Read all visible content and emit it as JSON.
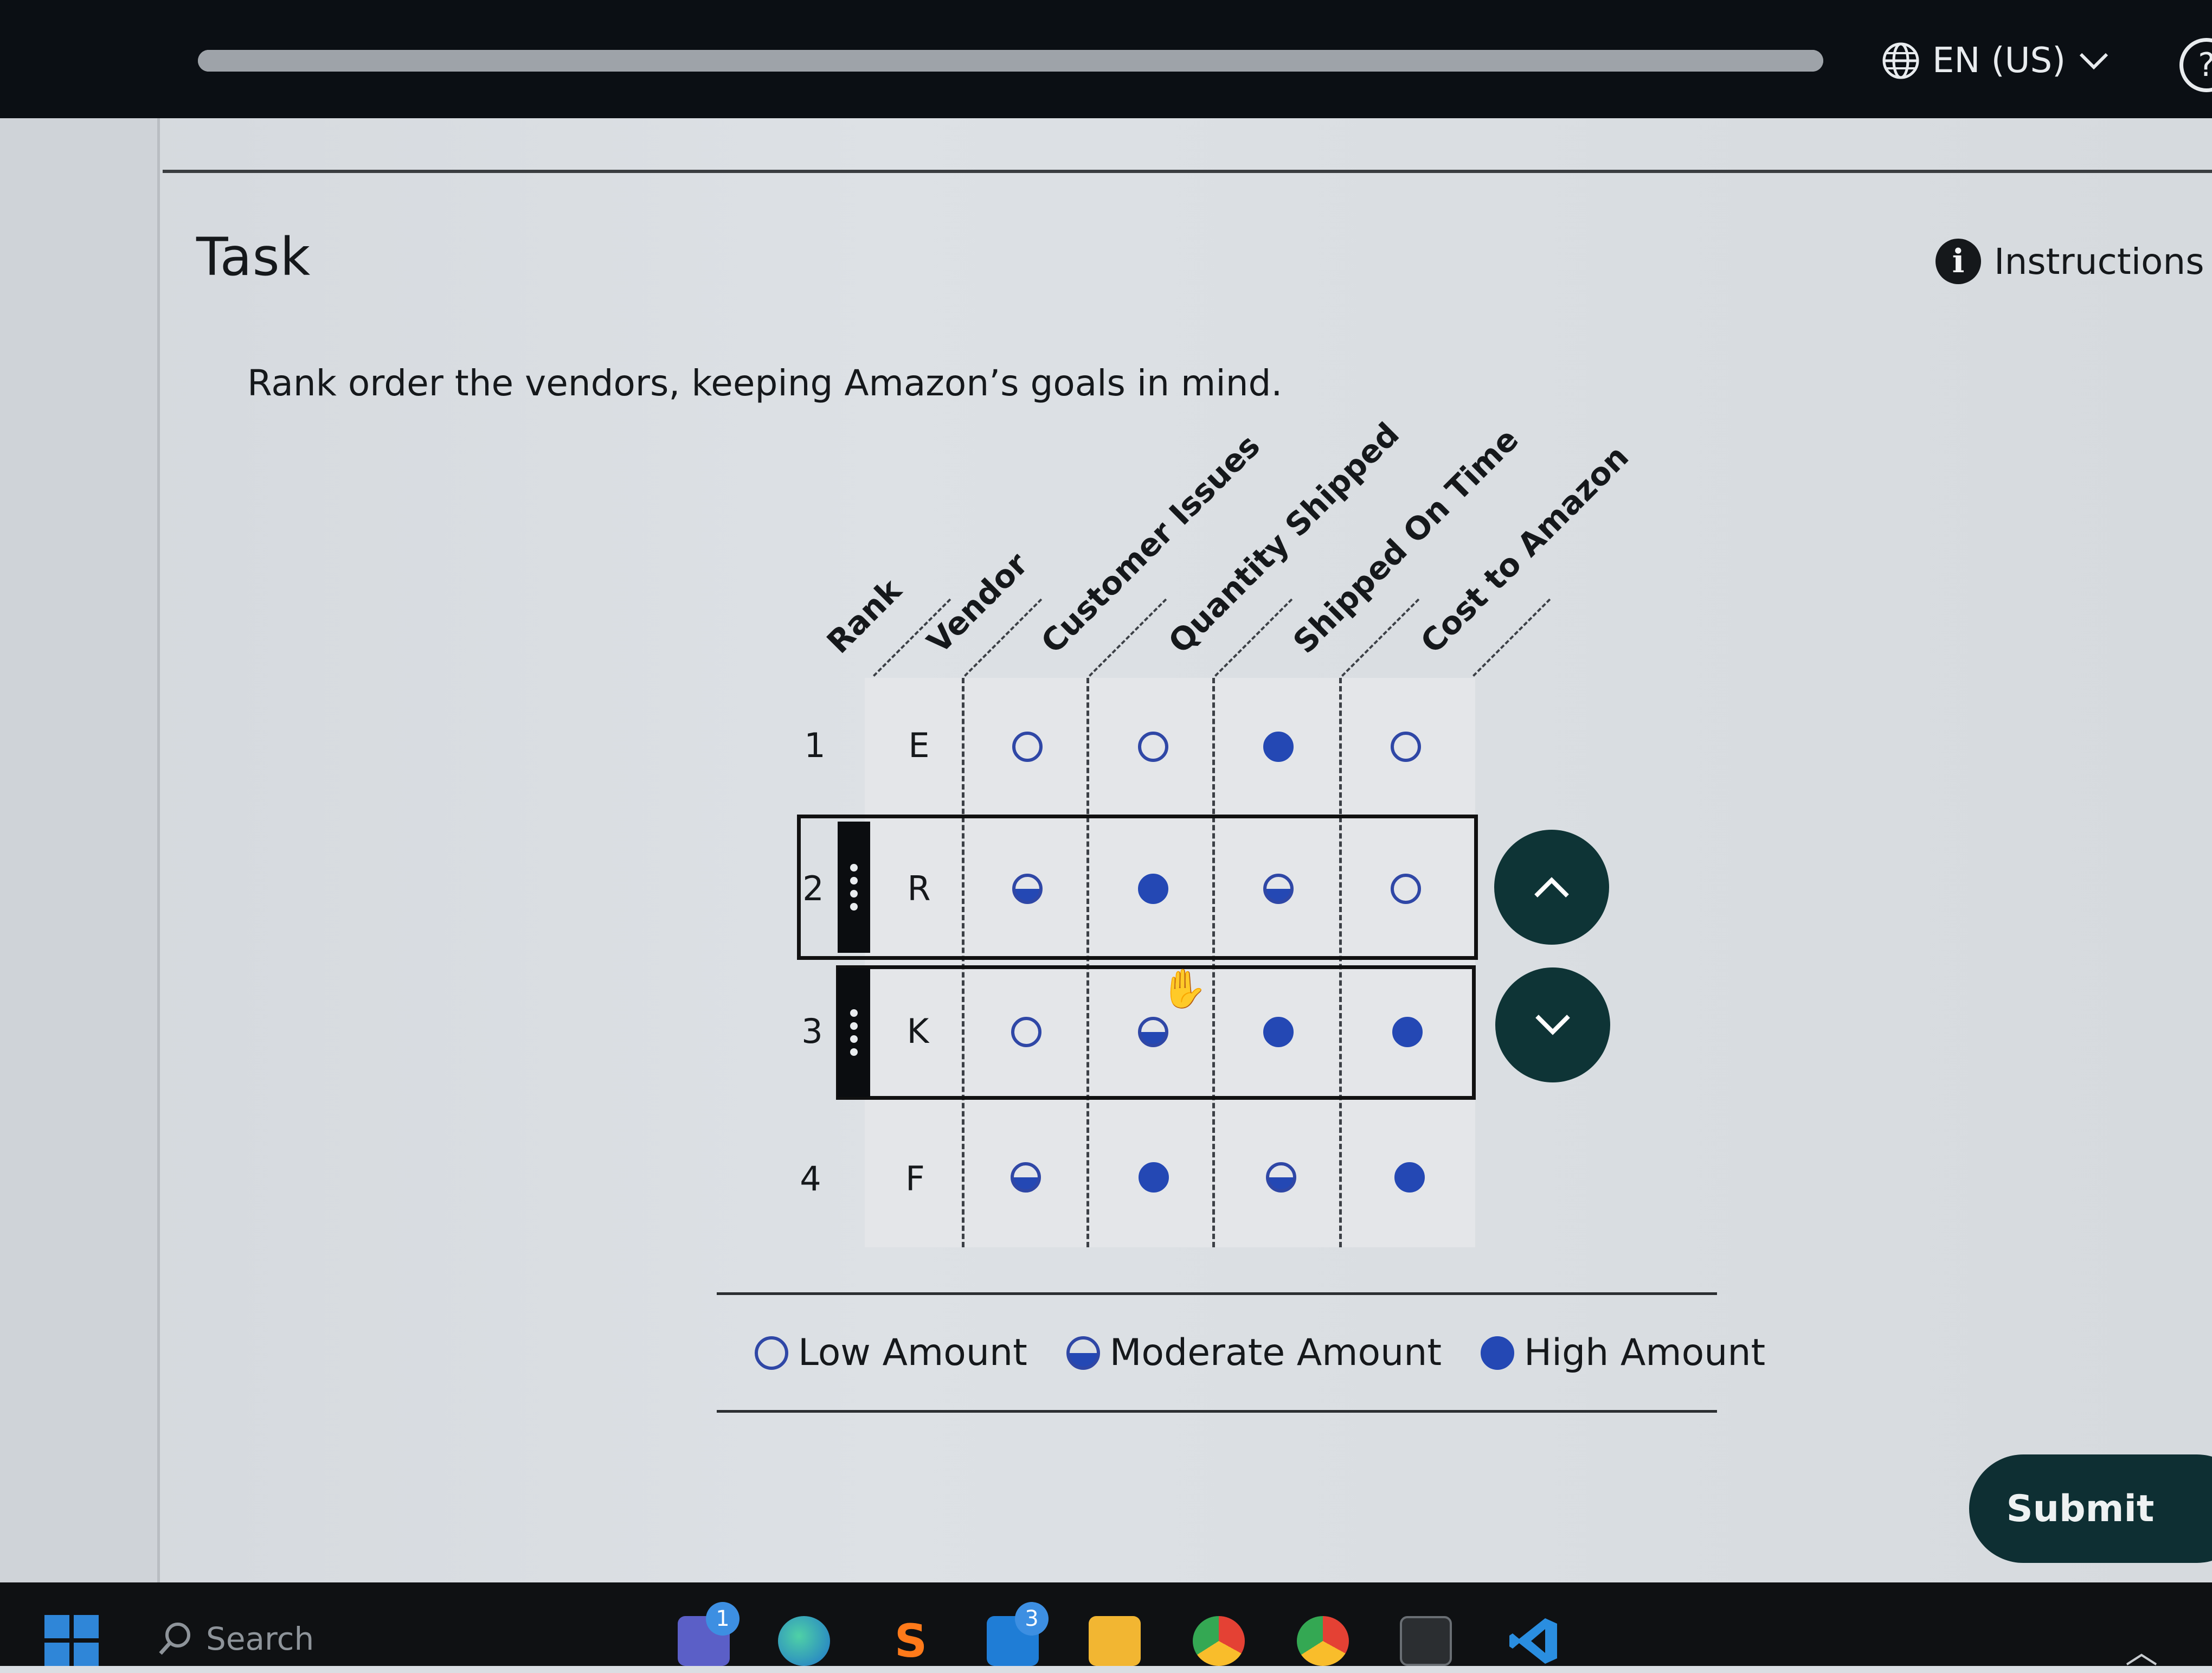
{
  "topbar": {
    "progress_fraction": 1.0,
    "language_label": "EN (US)",
    "language_icon": "globe-icon",
    "help_label": "?"
  },
  "task": {
    "title": "Task",
    "instructions_label": "Instructions",
    "instructions_icon": "info-icon",
    "prompt": "Rank order the vendors, keeping Amazon’s goals in mind."
  },
  "table": {
    "headers": [
      "Rank",
      "Vendor",
      "Customer Issues",
      "Quantity Shipped",
      "Shipped On Time",
      "Cost to Amazon"
    ],
    "rows": [
      {
        "rank": "1",
        "vendor": "E",
        "values": [
          "low",
          "low",
          "high",
          "low"
        ]
      },
      {
        "rank": "2",
        "vendor": "R",
        "values": [
          "moderate",
          "high",
          "moderate",
          "low"
        ]
      },
      {
        "rank": "3",
        "vendor": "K",
        "values": [
          "low",
          "moderate",
          "high",
          "high"
        ]
      },
      {
        "rank": "4",
        "vendor": "F",
        "values": [
          "moderate",
          "high",
          "moderate",
          "high"
        ]
      }
    ],
    "selected_row_rank": "2",
    "move_up_icon": "chevron-up-icon",
    "move_down_icon": "chevron-down-icon"
  },
  "legend": {
    "low": "Low Amount",
    "moderate": "Moderate Amount",
    "high": "High Amount"
  },
  "submit_label": "Submit",
  "taskbar": {
    "search_placeholder": "Search",
    "teams_badge": "1",
    "mail_badge": "3"
  },
  "colors": {
    "dot_blue": "#2448b4",
    "button_dark_teal": "#0e3436",
    "topbar": "#0b0f14"
  }
}
